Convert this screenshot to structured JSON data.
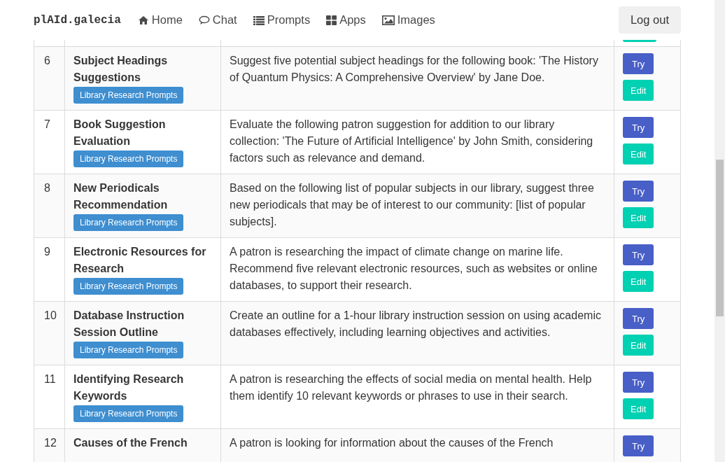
{
  "navbar": {
    "brand": "plAId.galecia",
    "links": [
      {
        "kind": "home",
        "label": "Home"
      },
      {
        "kind": "chat",
        "label": "Chat"
      },
      {
        "kind": "list",
        "label": "Prompts"
      },
      {
        "kind": "grid",
        "label": "Apps"
      },
      {
        "kind": "image",
        "label": "Images"
      }
    ],
    "logout": "Log out"
  },
  "rows": [
    {
      "number": "6",
      "title": "Subject Headings Suggestions",
      "category": "Library Research Prompts",
      "description": "Suggest five potential subject headings for the following book: 'The History of Quantum Physics: A Comprehensive Overview' by Jane Doe.",
      "try": "Try",
      "edit": "Edit"
    },
    {
      "number": "7",
      "title": "Book Suggestion Evaluation",
      "category": "Library Research Prompts",
      "description": "Evaluate the following patron suggestion for addition to our library collection: 'The Future of Artificial Intelligence' by John Smith, considering factors such as relevance and demand.",
      "try": "Try",
      "edit": "Edit"
    },
    {
      "number": "8",
      "title": "New Periodicals Recommendation",
      "category": "Library Research Prompts",
      "description": "Based on the following list of popular subjects in our library, suggest three new periodicals that may be of interest to our community: [list of popular subjects].",
      "try": "Try",
      "edit": "Edit"
    },
    {
      "number": "9",
      "title": "Electronic Resources for Research",
      "category": "Library Research Prompts",
      "description": "A patron is researching the impact of climate change on marine life. Recommend five relevant electronic resources, such as websites or online databases, to support their research.",
      "try": "Try",
      "edit": "Edit"
    },
    {
      "number": "10",
      "title": "Database Instruction Session Outline",
      "category": "Library Research Prompts",
      "description": "Create an outline for a 1-hour library instruction session on using academic databases effectively, including learning objectives and activities.",
      "try": "Try",
      "edit": "Edit"
    },
    {
      "number": "11",
      "title": "Identifying Research Keywords",
      "category": "Library Research Prompts",
      "description": "A patron is researching the effects of social media on mental health. Help them identify 10 relevant keywords or phrases to use in their search.",
      "try": "Try",
      "edit": "Edit"
    },
    {
      "number": "12",
      "title": "Causes of the French",
      "description": "A patron is looking for information about the causes of the French",
      "try": "Try"
    }
  ]
}
